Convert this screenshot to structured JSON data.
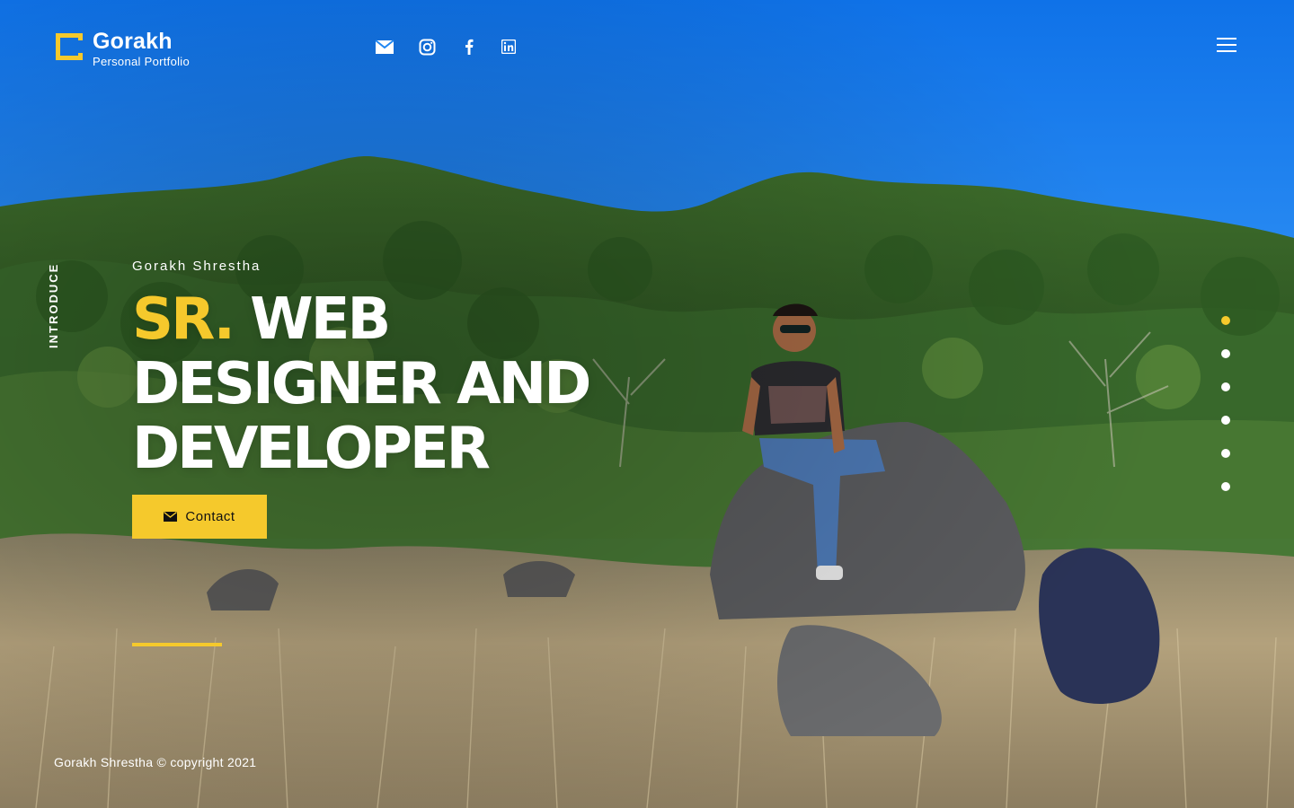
{
  "header": {
    "logo_name": "Gorakh",
    "logo_subtitle": "Personal Portfolio",
    "social_icons": [
      "envelope-icon",
      "instagram-icon",
      "facebook-icon",
      "linkedin-icon"
    ],
    "menu_icon": "hamburger-icon"
  },
  "side_label": "INTRODUCE",
  "hero": {
    "name": "Gorakh Shrestha",
    "title_accent": "SR.",
    "title_rest": "WEB DESIGNER AND DEVELOPER",
    "contact_label": "Contact"
  },
  "pager": {
    "count": 6,
    "active_index": 0
  },
  "footer": {
    "copyright": "Gorakh Shrestha © copyright 2021"
  },
  "colors": {
    "accent": "#f5c92c",
    "sky": "#1f86f2",
    "text": "#ffffff"
  }
}
